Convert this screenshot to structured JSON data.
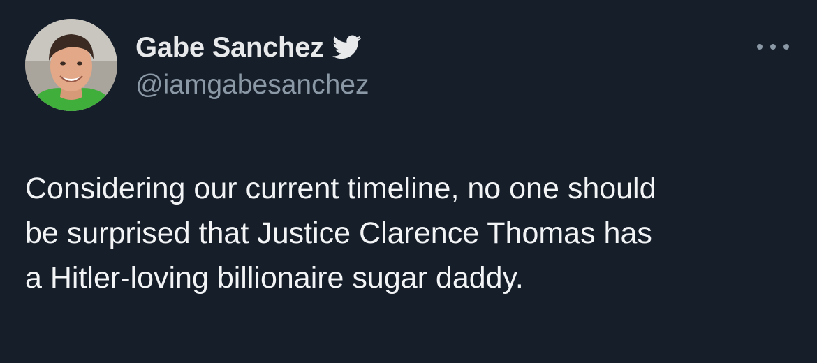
{
  "author": {
    "display_name": "Gabe Sanchez",
    "handle": "@iamgabesanchez",
    "verified_icon": "twitter-bird-icon",
    "verified_color": "#e7e9ea",
    "avatar_icon": "profile-photo"
  },
  "menu": {
    "icon": "more-options-icon"
  },
  "tweet": {
    "text": "Considering our current timeline, no one should\nbe surprised that Justice Clarence Thomas has\na Hitler-loving billionaire sugar daddy."
  },
  "colors": {
    "background": "#161e2a",
    "text": "#e7e9ea",
    "secondary_text": "#8b98a5"
  }
}
